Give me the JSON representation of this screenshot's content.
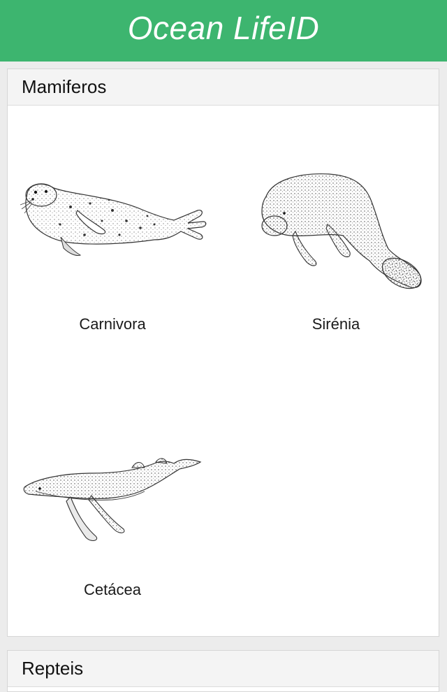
{
  "header": {
    "title": "Ocean LifeID",
    "background_color": "#3db56f"
  },
  "sections": [
    {
      "title": "Mamiferos",
      "items": [
        {
          "label": "Carnivora",
          "icon": "seal-illustration"
        },
        {
          "label": "Sirénia",
          "icon": "manatee-illustration"
        },
        {
          "label": "Cetácea",
          "icon": "humpback-whale-illustration"
        }
      ]
    },
    {
      "title": "Repteis",
      "items": []
    }
  ]
}
